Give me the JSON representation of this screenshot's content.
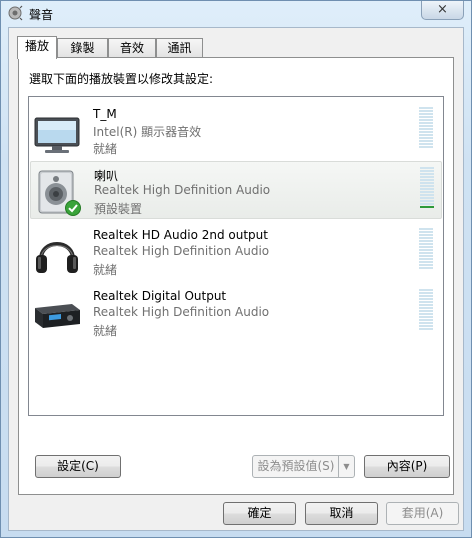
{
  "window": {
    "title": "聲音",
    "close_icon": "×"
  },
  "tabs": [
    {
      "label": "播放"
    },
    {
      "label": "錄製"
    },
    {
      "label": "音效"
    },
    {
      "label": "通訊"
    }
  ],
  "instruction": "選取下面的播放裝置以修改其設定:",
  "devices": [
    {
      "name": "T_M",
      "description": "Intel(R) 顯示器音效",
      "status": "就緒",
      "icon": "monitor-icon",
      "selected": false,
      "level": 0
    },
    {
      "name": "喇叭",
      "description": "Realtek High Definition Audio",
      "status": "預設裝置",
      "icon": "speaker-icon",
      "selected": true,
      "level": 1
    },
    {
      "name": "Realtek HD Audio 2nd output",
      "description": "Realtek High Definition Audio",
      "status": "就緒",
      "icon": "headphones-icon",
      "selected": false,
      "level": 0
    },
    {
      "name": "Realtek Digital Output",
      "description": "Realtek High Definition Audio",
      "status": "就緒",
      "icon": "digital-receiver-icon",
      "selected": false,
      "level": 0
    }
  ],
  "buttons": {
    "configure": "設定(C)",
    "set_default": "設為預設值(S)",
    "properties": "內容(P)",
    "ok": "確定",
    "cancel": "取消",
    "apply": "套用(A)"
  },
  "colors": {
    "default_check": "#3aa33a",
    "meter_active": "#2e9a3a",
    "meter_idle": "#cfe3ee"
  }
}
